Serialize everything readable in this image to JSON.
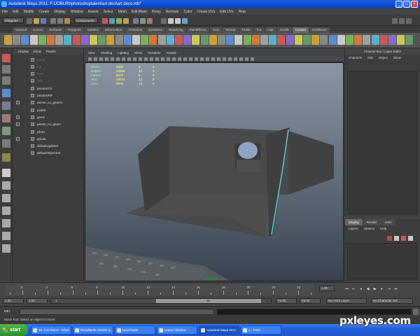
{
  "window": {
    "title": "Autodesk Maya 2011: F:\\JOBURI\\photoshoptalent\\art deci\\art deco.mb*",
    "min": "_",
    "max": "□",
    "close": "×"
  },
  "menubar": [
    "File",
    "Edit",
    "Modify",
    "Create",
    "Display",
    "Window",
    "Assets",
    "Select",
    "Mesh",
    "Edit Mesh",
    "Proxy",
    "Normals",
    "Color",
    "Create UVs",
    "Edit UVs",
    "Help"
  ],
  "statusline": {
    "menuset": "Polygons",
    "selection_mode": "Components"
  },
  "shelf": {
    "tabs": [
      "General",
      "Curves",
      "Surfaces",
      "Polygons",
      "Subdivs",
      "Deformation",
      "Animation",
      "Dynamics",
      "Rendering",
      "PaintEffects",
      "Toon",
      "Muscle",
      "Fluids",
      "Fur",
      "Hair",
      "nCloth",
      "Custom",
      "GoZBrush"
    ],
    "active_tab": "Custom"
  },
  "outliner": {
    "menu": [
      "Display",
      "Show",
      "Panels"
    ],
    "items": [
      {
        "label": "persp",
        "dim": true,
        "plus": false
      },
      {
        "label": "top",
        "dim": true,
        "plus": false
      },
      {
        "label": "front",
        "dim": true,
        "plus": false
      },
      {
        "label": "side",
        "dim": true,
        "plus": false
      },
      {
        "label": "perete5TG",
        "dim": false,
        "plus": false
      },
      {
        "label": "pereteDRP",
        "dim": false,
        "plus": false
      },
      {
        "label": "perete_cu_geam1",
        "dim": false,
        "plus": true
      },
      {
        "label": "podea",
        "dim": false,
        "plus": false
      },
      {
        "label": "geam",
        "dim": false,
        "plus": true
      },
      {
        "label": "perete_cu_geam",
        "dim": false,
        "plus": true
      },
      {
        "label": "plinta",
        "dim": false,
        "plus": false
      },
      {
        "label": "grinda",
        "dim": false,
        "plus": true
      },
      {
        "label": "defaultLightSet",
        "dim": false,
        "plus": false
      },
      {
        "label": "defaultObjectSet",
        "dim": false,
        "plus": false
      }
    ]
  },
  "viewport": {
    "menu": [
      "View",
      "Shading",
      "Lighting",
      "Show",
      "Renderer",
      "Panels"
    ],
    "hud": [
      {
        "label": "Verts:",
        "a": "5520",
        "b": "8",
        "c": "0"
      },
      {
        "label": "Edges:",
        "a": "10486",
        "b": "12",
        "c": "0"
      },
      {
        "label": "Faces:",
        "a": "5474",
        "b": "6",
        "c": "0"
      },
      {
        "label": "Tris:",
        "a": "10024",
        "b": "12",
        "c": "0"
      },
      {
        "label": "UVs:",
        "a": "6870",
        "b": "14",
        "c": "0"
      }
    ]
  },
  "channelbox": {
    "title": "Channel Box / Layer Editor",
    "menu": [
      "Channels",
      "Edit",
      "Object",
      "Show"
    ]
  },
  "layereditor": {
    "tabs": [
      "Display",
      "Render",
      "Anim"
    ],
    "active_tab": "Display",
    "menu": [
      "Layers",
      "Options",
      "Help"
    ]
  },
  "timeslider": {
    "ticks": [
      "2",
      "4",
      "6",
      "8",
      "10",
      "12",
      "14",
      "16",
      "18",
      "20",
      "22",
      "24"
    ],
    "current_frame": "1.00"
  },
  "rangeslider": {
    "start": "1.00",
    "playback_start": "1.00",
    "range_start": "1",
    "range_end": "25",
    "playback_end": "24.00",
    "end": "48.00",
    "anim_layer": "No Anim Layer",
    "character_set": "No Character Set"
  },
  "cmdline": {
    "label": "MEL"
  },
  "helpline": {
    "text": "Move Tool: Select an object to move."
  },
  "taskbar": {
    "start": "start",
    "tasks": [
      {
        "label": "40. Port Mirror - Wher...",
        "active": false
      },
      {
        "label": "Rezultatele căutării d...",
        "active": false
      },
      {
        "label": "Downloads",
        "active": false
      },
      {
        "label": "Output Window",
        "active": false
      },
      {
        "label": "Autodesk Maya 2011: ...",
        "active": true
      },
      {
        "label": "6 - Paint",
        "active": false
      }
    ]
  },
  "watermark": "pxleyes.com",
  "colors": {
    "ui_bg": "#444444",
    "hud_value": "#e9e96c",
    "hud_label": "#a6e0a6",
    "selection": "#5ad7e6"
  }
}
